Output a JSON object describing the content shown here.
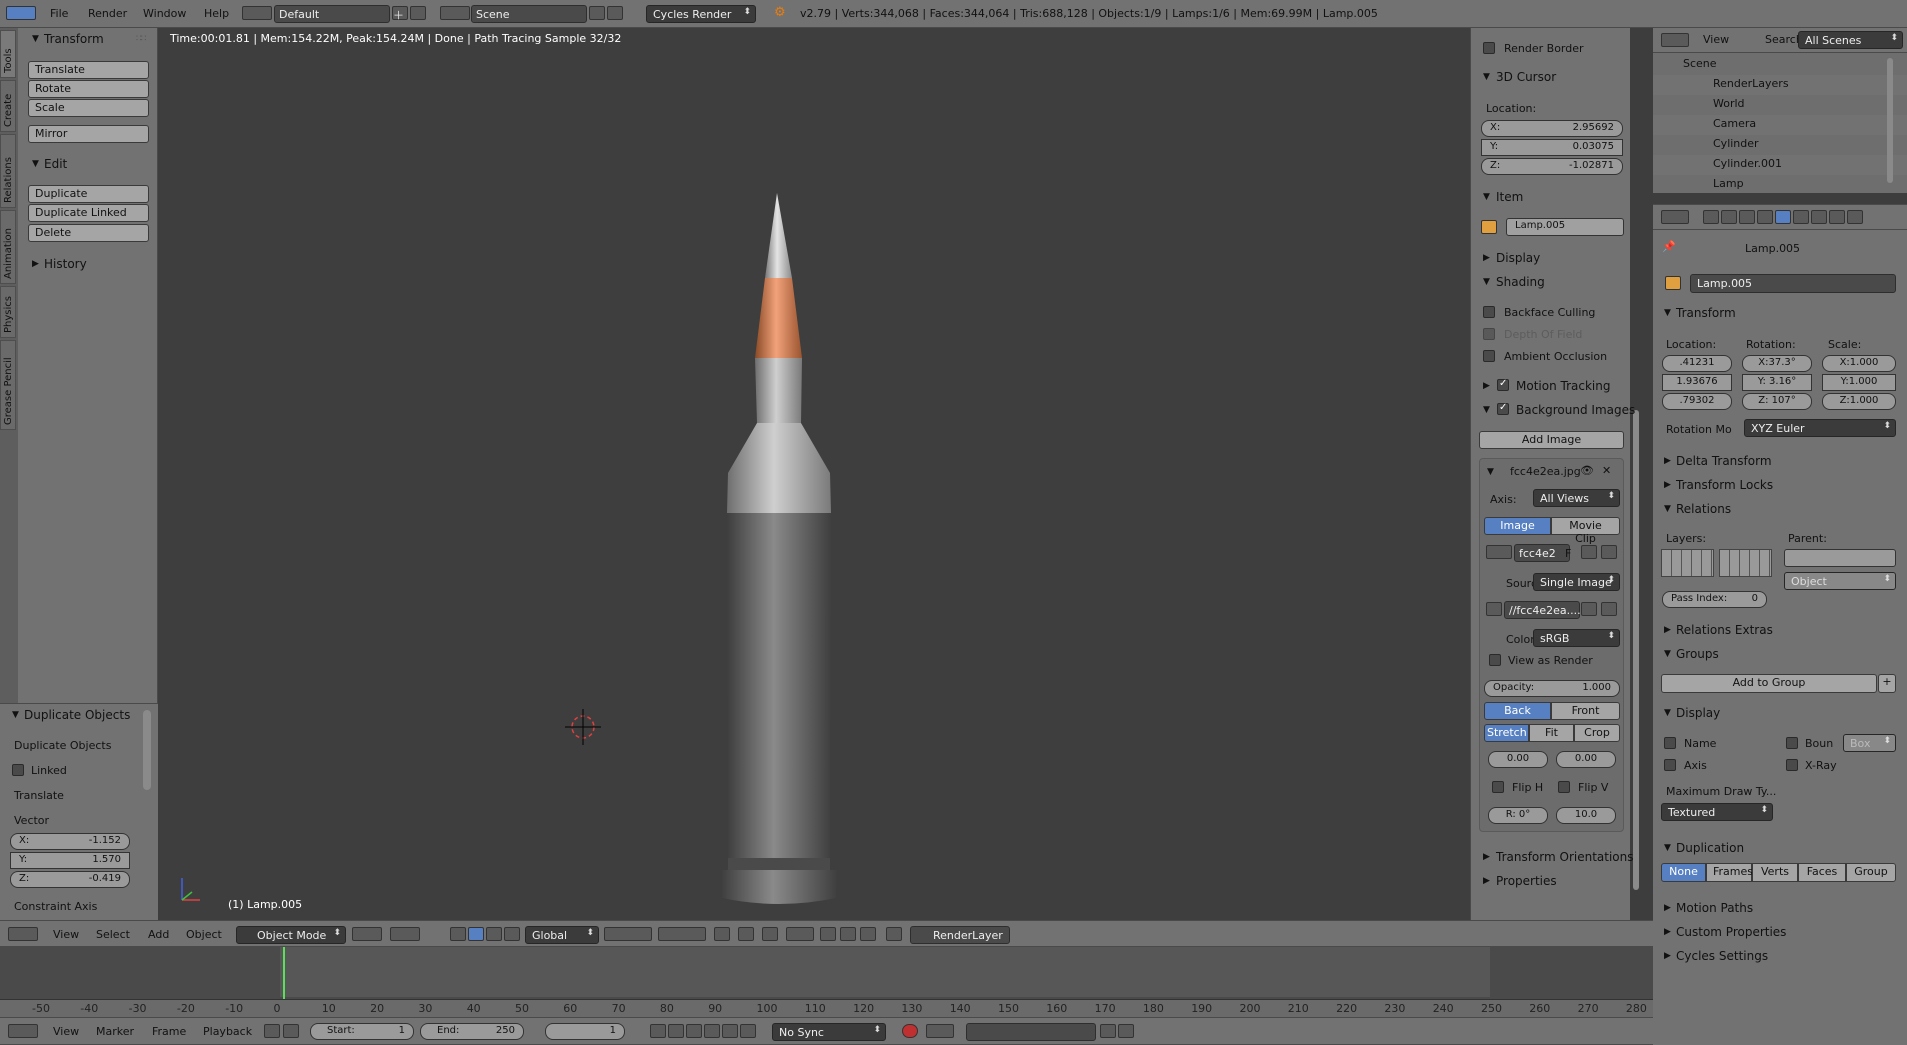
{
  "topbar": {
    "menus": [
      "File",
      "Render",
      "Window",
      "Help"
    ],
    "layout": "Default",
    "scene": "Scene",
    "engine": "Cycles Render",
    "stats": "v2.79 | Verts:344,068 | Faces:344,064 | Tris:688,128 | Objects:1/9 | Lamps:1/6 | Mem:69.99M | Lamp.005"
  },
  "toolshelf": {
    "tabs": [
      "Tools",
      "Create",
      "Relations",
      "Animation",
      "Physics",
      "Grease Pencil"
    ],
    "transform_title": "Transform",
    "transform_buttons": [
      "Translate",
      "Rotate",
      "Scale"
    ],
    "mirror": "Mirror",
    "edit_title": "Edit",
    "edit_buttons": [
      "Duplicate",
      "Duplicate Linked",
      "Delete"
    ],
    "history": "History"
  },
  "operator": {
    "title": "Duplicate Objects",
    "name": "Duplicate Objects",
    "linked": "Linked",
    "translate": "Translate",
    "vector": "Vector",
    "x_label": "X:",
    "x": "-1.152",
    "y_label": "Y:",
    "y": "1.570",
    "z_label": "Z:",
    "z": "-0.419",
    "constraint": "Constraint Axis"
  },
  "viewport": {
    "render_info": "Time:00:01.81 | Mem:154.22M, Peak:154.24M | Done | Path Tracing Sample 32/32",
    "object_label": "(1) Lamp.005"
  },
  "viewport_header": {
    "menus": [
      "View",
      "Select",
      "Add",
      "Object"
    ],
    "mode": "Object Mode",
    "orientation": "Global",
    "render_layer": "RenderLayer"
  },
  "npanel": {
    "render_border": "Render Border",
    "cursor_title": "3D Cursor",
    "location": "Location:",
    "cx_label": "X:",
    "cx": "2.95692",
    "cy_label": "Y:",
    "cy": "0.03075",
    "cz_label": "Z:",
    "cz": "-1.02871",
    "item_title": "Item",
    "item_name": "Lamp.005",
    "display": "Display",
    "shading": "Shading",
    "backface": "Backface Culling",
    "dof": "Depth Of Field",
    "ao": "Ambient Occlusion",
    "motion_tracking": "Motion Tracking",
    "bg_images": "Background Images",
    "add_image": "Add Image",
    "image_file": "fcc4e2ea.jpg",
    "axis_label": "Axis:",
    "axis_value": "All Views",
    "tab_image": "Image",
    "tab_movie": "Movie Clip",
    "img_short": "fcc4e2",
    "img_f": "F",
    "source_label": "Source",
    "source_value": "Single Image",
    "path": "//fcc4e2ea....",
    "color_label": "Color",
    "color_value": "sRGB",
    "view_as_render": "View as Render",
    "opacity_label": "Opacity:",
    "opacity": "1.000",
    "back": "Back",
    "front": "Front",
    "stretch": "Stretch",
    "fit": "Fit",
    "crop": "Crop",
    "offx": "0.00",
    "offy": "0.00",
    "fliph": "Flip H",
    "flipv": "Flip V",
    "rot": "R: 0°",
    "size": "10.0",
    "transform_orient": "Transform Orientations",
    "properties": "Properties"
  },
  "outliner": {
    "menus": [
      "View",
      "Search"
    ],
    "filter": "All Scenes",
    "items": [
      "Scene",
      "RenderLayers",
      "World",
      "Camera",
      "Cylinder",
      "Cylinder.001",
      "Lamp"
    ]
  },
  "properties": {
    "breadcrumb": "Lamp.005",
    "object_name": "Lamp.005",
    "transform": "Transform",
    "location": "Location:",
    "rotation": "Rotation:",
    "scale": "Scale:",
    "loc": [
      ".41231",
      "1.93676",
      ".79302"
    ],
    "rot": [
      "X:37.3°",
      "Y: 3.16°",
      "Z: 107°"
    ],
    "scl": [
      "X:1.000",
      "Y:1.000",
      "Z:1.000"
    ],
    "rot_mode_label": "Rotation Mo",
    "rot_mode": "XYZ Euler",
    "delta": "Delta Transform",
    "locks": "Transform Locks",
    "relations": "Relations",
    "layers": "Layers:",
    "parent": "Parent:",
    "parent_type": "Object",
    "pass_index": "Pass Index:",
    "pass_value": "0",
    "rel_extras": "Relations Extras",
    "groups": "Groups",
    "add_group": "Add to Group",
    "display": "Display",
    "name": "Name",
    "bounds": "Boun",
    "box": "Box",
    "axis": "Axis",
    "xray": "X-Ray",
    "max_draw": "Maximum Draw Ty...",
    "textured": "Textured",
    "duplication": "Duplication",
    "dup_modes": [
      "None",
      "Frames",
      "Verts",
      "Faces",
      "Group"
    ],
    "motion_paths": "Motion Paths",
    "custom_props": "Custom Properties",
    "cycles": "Cycles Settings"
  },
  "timeline": {
    "ticks": [
      "-50",
      "-40",
      "-30",
      "-20",
      "-10",
      "0",
      "10",
      "20",
      "30",
      "40",
      "50",
      "60",
      "70",
      "80",
      "90",
      "100",
      "110",
      "120",
      "130",
      "140",
      "150",
      "160",
      "170",
      "180",
      "190",
      "200",
      "210",
      "220",
      "230",
      "240",
      "250",
      "260",
      "270",
      "280"
    ],
    "menus": [
      "View",
      "Marker",
      "Frame",
      "Playback"
    ],
    "start_label": "Start:",
    "start": "1",
    "end_label": "End:",
    "end": "250",
    "current": "1",
    "sync": "No Sync"
  }
}
